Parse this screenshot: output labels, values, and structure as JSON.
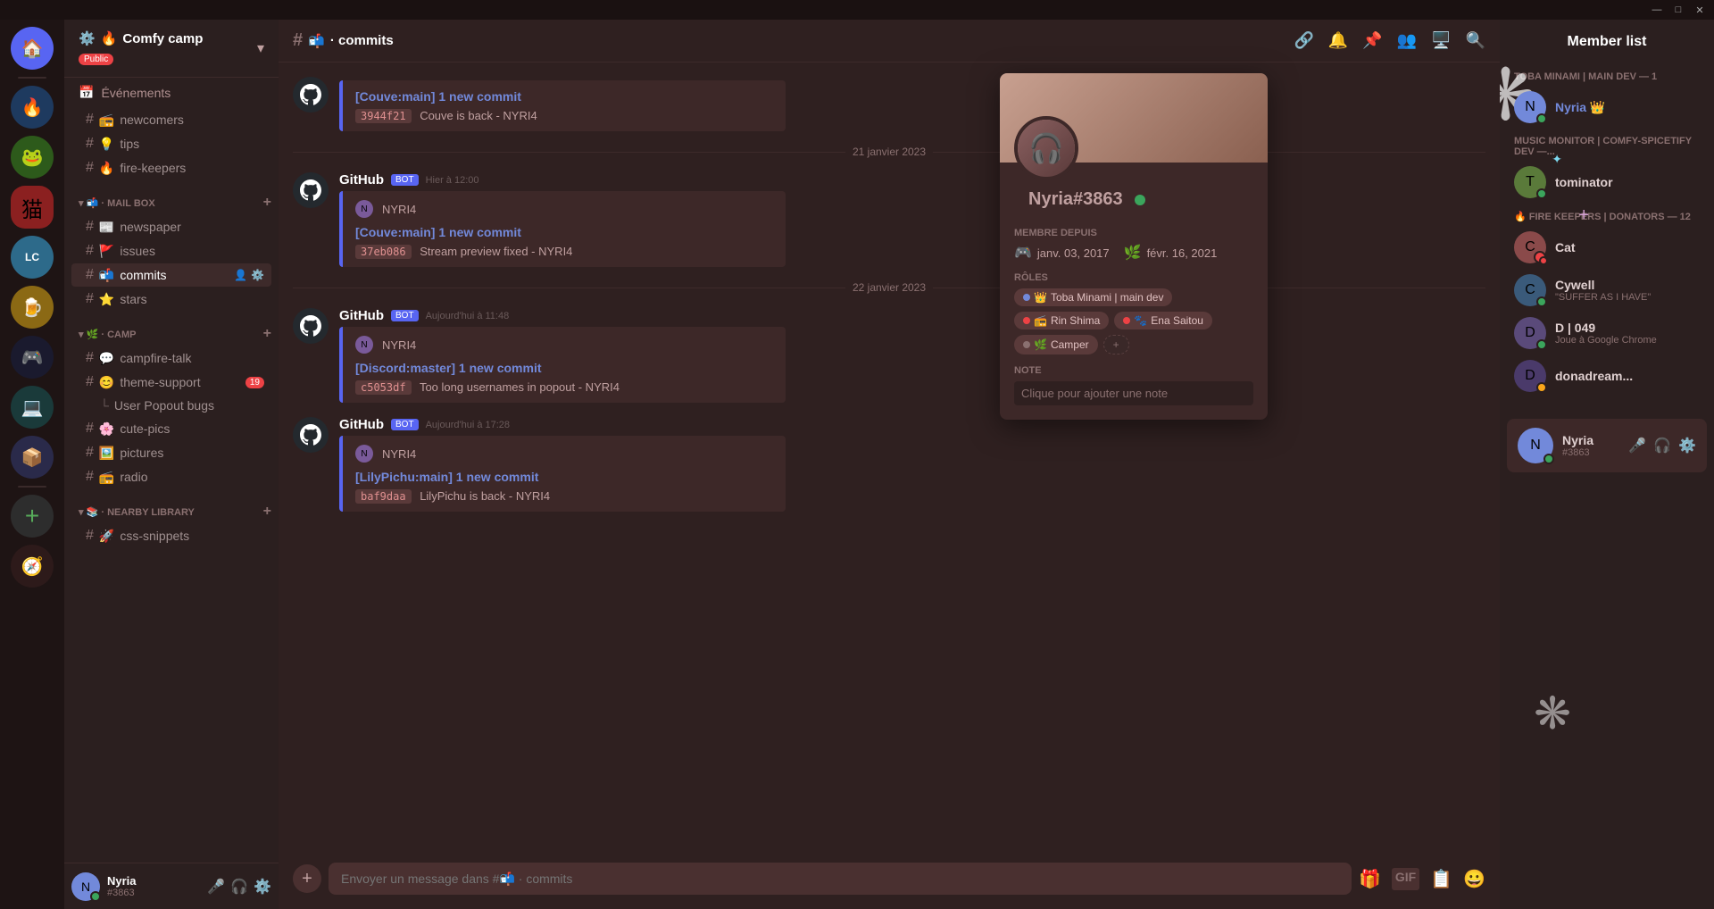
{
  "titlebar": {
    "minimize": "—",
    "maximize": "□",
    "close": "✕"
  },
  "servers": [
    {
      "id": "discord",
      "icon": "🏠",
      "class": "discord"
    },
    {
      "id": "flame",
      "icon": "🔥",
      "class": "flame"
    },
    {
      "id": "green",
      "icon": "🐸",
      "class": "green"
    },
    {
      "id": "cat",
      "icon": "猫",
      "class": "cat"
    },
    {
      "id": "lc",
      "icon": "LC",
      "class": "lc"
    },
    {
      "id": "yellow",
      "icon": "🍺",
      "class": "yellow"
    },
    {
      "id": "among",
      "icon": "🎮",
      "class": "among"
    },
    {
      "id": "teal",
      "icon": "💻",
      "class": "teal"
    },
    {
      "id": "stacked",
      "icon": "📦",
      "class": "stacked"
    }
  ],
  "server": {
    "name": "Comfy camp",
    "badge": "Public",
    "settings_icon": "⚙️",
    "fire_icon": "🔥"
  },
  "sidebar": {
    "events_label": "Événements",
    "categories": [
      {
        "name": "",
        "channels": [
          {
            "hash": "#",
            "icon": "📻",
            "name": "newcomers"
          },
          {
            "hash": "#",
            "icon": "💡",
            "name": "tips"
          },
          {
            "hash": "#",
            "icon": "🔥",
            "name": "fire-keepers"
          }
        ]
      },
      {
        "name": "MAIL BOX",
        "icon": "📬",
        "channels": [
          {
            "hash": "#",
            "icon": "📰",
            "name": "newspaper"
          },
          {
            "hash": "#",
            "icon": "🚩",
            "name": "issues"
          },
          {
            "hash": "#",
            "icon": "📬",
            "name": "commits",
            "active": true
          },
          {
            "hash": "#",
            "icon": "⭐",
            "name": "stars"
          }
        ]
      },
      {
        "name": "CAMP",
        "icon": "🌿",
        "channels": [
          {
            "hash": "#",
            "icon": "💬",
            "name": "campfire-talk"
          },
          {
            "hash": "#",
            "icon": "😊",
            "name": "theme-support",
            "badge": "19"
          },
          {
            "indent": true,
            "name": "User Popout bugs"
          },
          {
            "hash": "#",
            "icon": "🌸",
            "name": "cute-pics"
          },
          {
            "hash": "#",
            "icon": "🖼️",
            "name": "pictures"
          },
          {
            "hash": "#",
            "icon": "📻",
            "name": "radio"
          }
        ]
      },
      {
        "name": "NEARBY LIBRARY",
        "icon": "📚",
        "channels": [
          {
            "hash": "#",
            "icon": "🚀",
            "name": "css-snippets"
          }
        ]
      }
    ]
  },
  "channel": {
    "name": "commits",
    "icon": "📬",
    "hash": "#"
  },
  "header_actions": [
    "🔗",
    "🔔",
    "📌",
    "👥",
    "🖥️",
    "🔍"
  ],
  "messages": [
    {
      "id": "msg1",
      "author": "GitHub",
      "is_bot": true,
      "avatar_type": "github",
      "time": "",
      "embeds": [
        {
          "title": "[Couve:main] 1 new commit",
          "hash": "3944f21",
          "description": "Couve is back - NYRI4"
        }
      ]
    },
    {
      "id": "date1",
      "type": "divider",
      "text": "21 janvier 2023"
    },
    {
      "id": "msg2",
      "author": "GitHub",
      "is_bot": true,
      "avatar_type": "github",
      "time": "Hier à 12:00",
      "embeds": [
        {
          "inner_avatar": "N",
          "inner_author": "NYRI4",
          "title": "[Couve:main] 1 new commit",
          "hash": "37eb086",
          "description": "Stream preview fixed - NYRI4"
        }
      ]
    },
    {
      "id": "date2",
      "type": "divider",
      "text": "22 janvier 2023"
    },
    {
      "id": "msg3",
      "author": "GitHub",
      "is_bot": true,
      "avatar_type": "github",
      "time": "Aujourd'hui à 11:48",
      "embeds": [
        {
          "inner_avatar": "N",
          "inner_author": "NYRI4",
          "title": "[Discord:master] 1 new commit",
          "hash": "c5053df",
          "description": "Too long usernames in popout - NYRI4"
        }
      ]
    },
    {
      "id": "msg4",
      "author": "GitHub",
      "is_bot": true,
      "avatar_type": "github",
      "time": "Aujourd'hui à 17:28",
      "embeds": [
        {
          "inner_avatar": "N",
          "inner_author": "NYRI4",
          "title": "[LilyPichu:main] 1 new commit",
          "hash": "baf9daa",
          "description": "LilyPichu is back - NYRI4"
        }
      ]
    }
  ],
  "input": {
    "placeholder": "Envoyer un message dans #📬 · commits"
  },
  "member_list": {
    "title": "Member list",
    "categories": [
      {
        "name": "TOBA MINAMI | MAIN DEV — 1",
        "members": [
          {
            "name": "Nyria",
            "suffix": "👑",
            "tag": "",
            "status": "online",
            "special": true
          }
        ]
      },
      {
        "name": "MUSIC MONITOR | COMFY-SPICETIFY DEV —...",
        "members": [
          {
            "name": "tominator",
            "tag": "",
            "status": "online"
          }
        ]
      },
      {
        "name": "FIRE KEEPERS | DONATORS — 12",
        "members": [
          {
            "name": "Cat",
            "tag": "",
            "status": "dnd"
          },
          {
            "name": "Cywell",
            "tag": "\"SUFFER AS I HAVE\"",
            "status": "online"
          },
          {
            "name": "D | 049",
            "tag": "Joue à Google Chrome",
            "status": "online"
          },
          {
            "name": "donadream...",
            "tag": "",
            "status": "idle"
          }
        ]
      }
    ]
  },
  "user_popout": {
    "username": "Nyria",
    "discriminator": "#3863",
    "online_label": "En ligne",
    "membre_depuis_label": "MEMBRE DEPUIS",
    "discord_date": "janv. 03, 2017",
    "server_date": "févr. 16, 2021",
    "roles_label": "RÔLES",
    "roles": [
      {
        "name": "Toba Minami | main dev",
        "color": "blue",
        "icon": "👑"
      },
      {
        "name": "Rin Shima",
        "color": "red"
      },
      {
        "name": "Ena Saitou",
        "color": "red",
        "icon": "🐾"
      },
      {
        "name": "Camper",
        "color": "gray",
        "icon": "🌿"
      }
    ],
    "note_label": "NOTE",
    "note_placeholder": "Clique pour ajouter une note"
  },
  "user_bar": {
    "name": "Nyria",
    "tag": "#3863"
  }
}
